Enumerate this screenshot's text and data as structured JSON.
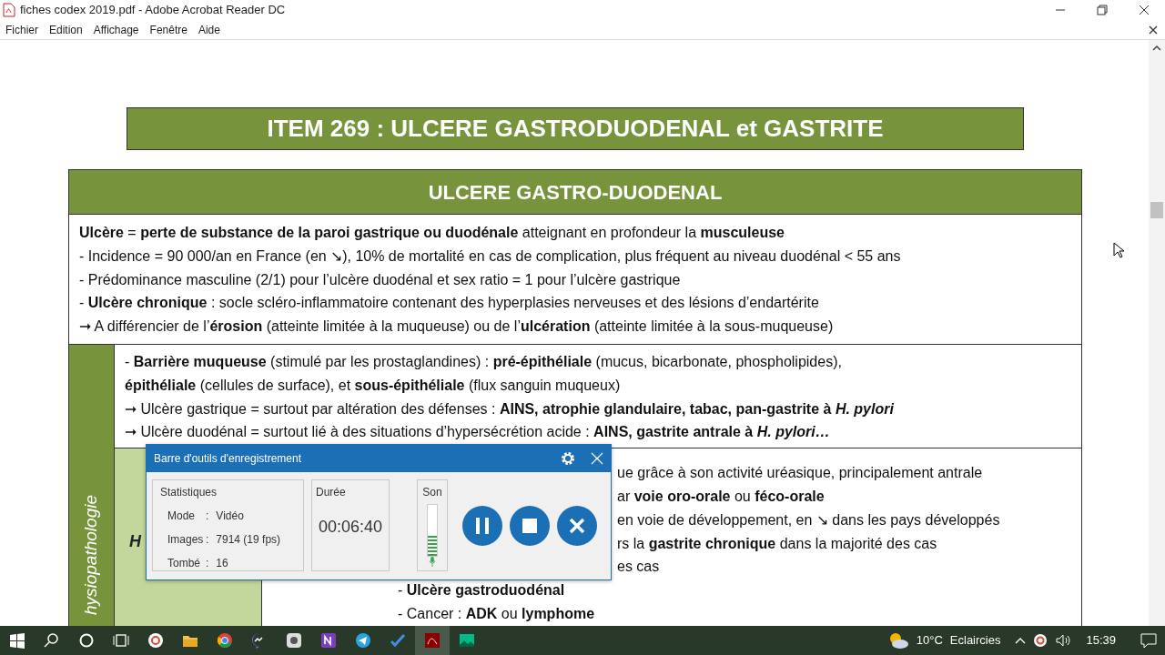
{
  "window": {
    "title": "fiches codex 2019.pdf - Adobe Acrobat Reader DC"
  },
  "menu": [
    "Fichier",
    "Edition",
    "Affichage",
    "Fenêtre",
    "Aide"
  ],
  "document": {
    "item_title": "ITEM 269 : ULCERE GASTRODUODENAL et GASTRITE",
    "section_title": "ULCERE GASTRO-DUODENAL",
    "intro_lines": [
      "**Ulcère** = **perte de substance de la paroi gastrique ou duodénale** atteignant en profondeur la **musculeuse**",
      "- Incidence = 90 000/an en France (en ↘), 10% de mortalité en cas de complication, plus fréquent au niveau duodénal < 55 ans",
      "- Prédominance masculine (2/1) pour l’ulcère duodénal et sex ratio = 1 pour l’ulcère gastrique",
      "- **Ulcère chronique** : socle scléro-inflammatoire contenant des hyperplasies nerveuses et des lésions d’endartérite",
      "➞ A différencier de l’**érosion** (atteinte limitée à la muqueuse) ou de l’**ulcération** (atteinte limitée à la sous-muqueuse)"
    ],
    "side_label": "hysiopathologie",
    "barrier_lines": [
      "- **Barrière muqueuse** (stimulé par les prostaglandines) : **pré-épithéliale** (mucus, bicarbonate, phospholipides),",
      "**épithéliale** (cellules de surface), et **sous-épithéliale** (flux sanguin muqueux)",
      "➞ Ulcère gastrique = surtout par altération des défenses : **AINS, atrophie glandulaire, tabac, pan-gastrite à** *H. pylori*",
      "➞ Ulcère duodénal = surtout lié à des situations d’hypersécrétion acide : **AINS, gastrite antrale à** *H. pylori…*"
    ],
    "pylori_label": "H",
    "pylori_lines": [
      {
        "kind": "partial",
        "text": "ue grâce à son activité uréasique, principalement antrale"
      },
      {
        "kind": "partial",
        "text": "ar **voie oro-orale** ou **féco-orale**"
      },
      {
        "kind": "partial",
        "text": "en voie de développement, en ↘ dans les pays développés"
      },
      {
        "kind": "partial",
        "text": "rs la **gastrite chronique** dans la majorité des cas"
      },
      {
        "kind": "partial",
        "text": "es cas"
      },
      {
        "kind": "full",
        "text": "- **Ulcère gastroduodénal**"
      },
      {
        "kind": "full",
        "text": "- Cancer : **ADK** ou **lymphome**"
      }
    ]
  },
  "recording_toolbar": {
    "title": "Barre d'outils d'enregistrement",
    "stats_label": "Statistiques",
    "stats": [
      {
        "label": "Mode",
        "separator": ":",
        "value": "Vidéo"
      },
      {
        "label": "Images",
        "separator": ":",
        "value": "7914 (19 fps)"
      },
      {
        "label": "Tombé",
        "separator": ":",
        "value": "16"
      }
    ],
    "duration_label": "Durée",
    "duration": "00:06:40",
    "sound_label": "Son",
    "sound": {
      "level": 0.4
    }
  },
  "taskbar": {
    "temperature": "10°C",
    "weather": "Eclaircies",
    "clock": "15:39"
  }
}
